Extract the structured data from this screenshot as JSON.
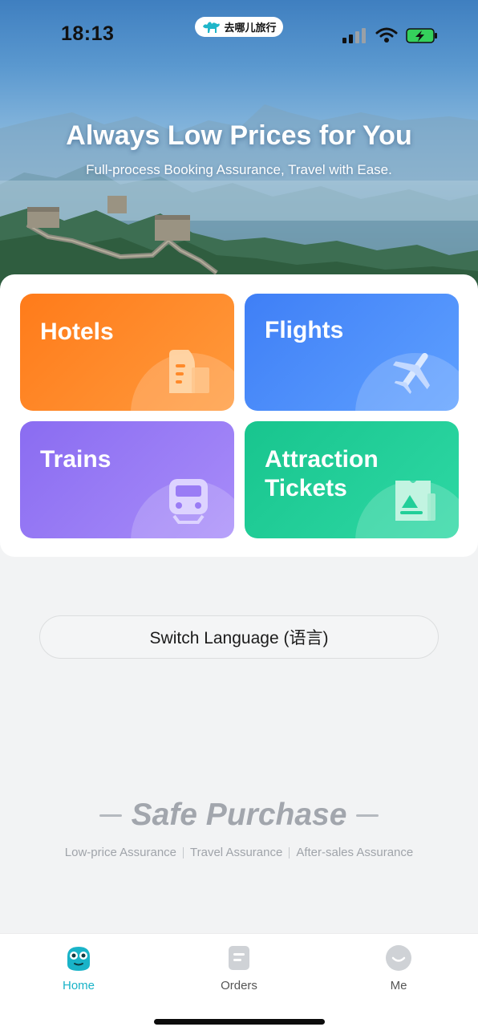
{
  "status_bar": {
    "time": "18:13",
    "app_name": "去哪儿旅行"
  },
  "hero": {
    "title": "Always Low Prices for You",
    "subtitle": "Full-process Booking Assurance, Travel with Ease."
  },
  "tiles": [
    {
      "label": "Hotels",
      "icon": "hotel-building-icon",
      "color": "#ff8a2a"
    },
    {
      "label": "Flights",
      "icon": "airplane-icon",
      "color": "#4b8cf8"
    },
    {
      "label": "Trains",
      "icon": "train-icon",
      "color": "#9a7cf5"
    },
    {
      "label": "Attraction Tickets",
      "icon": "ticket-icon",
      "color": "#22cf99"
    }
  ],
  "language_button": {
    "label": "Switch Language (语言)"
  },
  "safe_purchase": {
    "title": "Safe Purchase",
    "items": [
      "Low-price Assurance",
      "Travel Assurance",
      "After-sales Assurance"
    ]
  },
  "tabbar": {
    "items": [
      {
        "label": "Home",
        "icon": "home-mascot-icon",
        "active": true,
        "color": "#19b3c8"
      },
      {
        "label": "Orders",
        "icon": "orders-icon",
        "active": false
      },
      {
        "label": "Me",
        "icon": "profile-icon",
        "active": false
      }
    ]
  }
}
